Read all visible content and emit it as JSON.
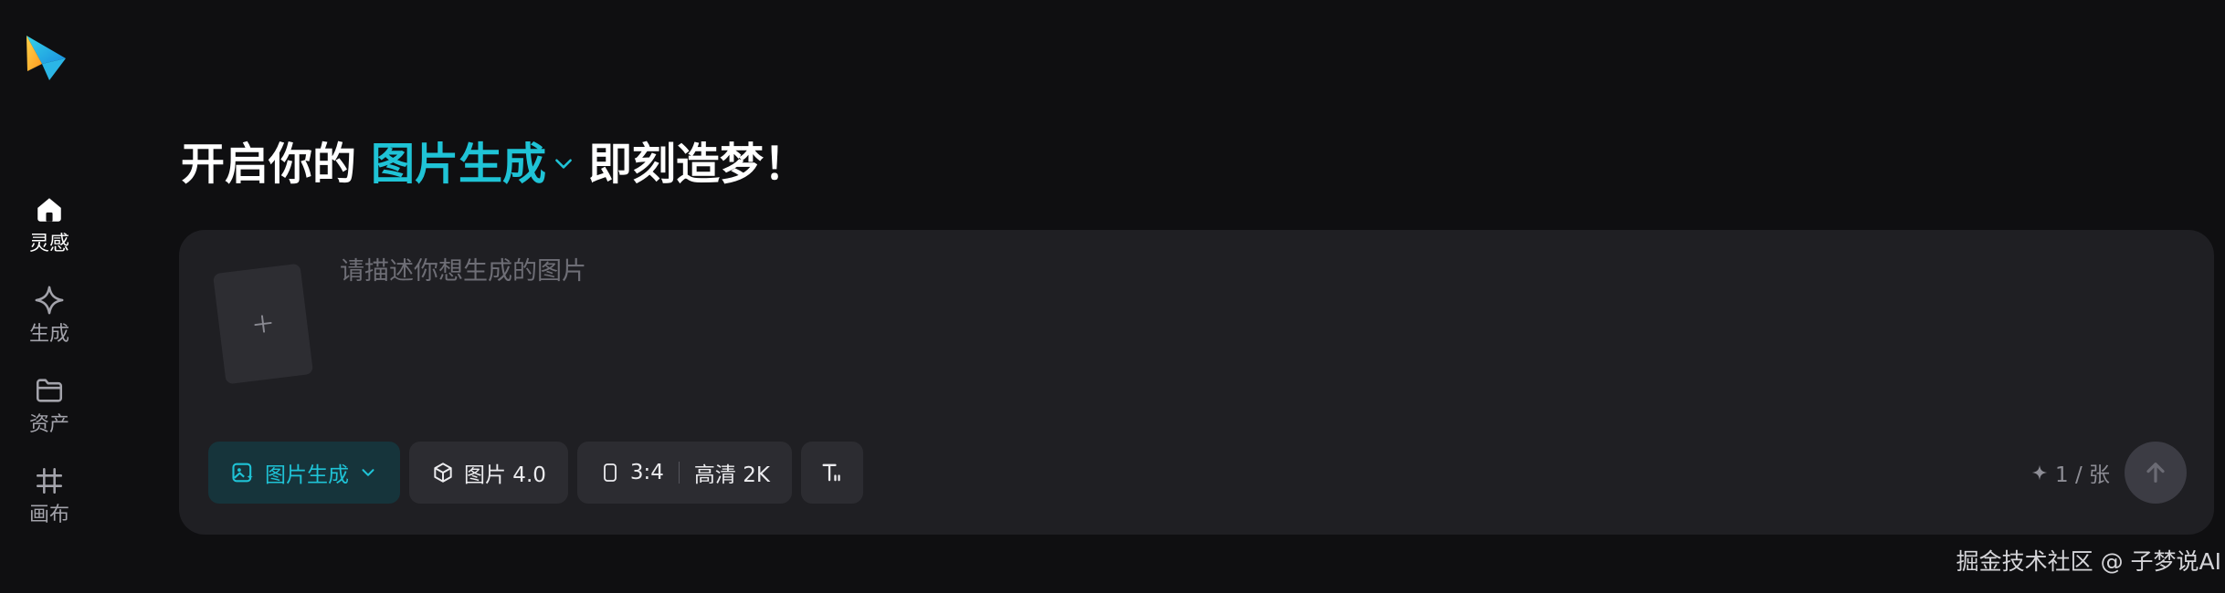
{
  "app": {
    "logo_icon": "paper-plane-logo-icon"
  },
  "sidebar": {
    "items": [
      {
        "label": "灵感",
        "icon": "home-icon",
        "active": true
      },
      {
        "label": "生成",
        "icon": "sparkle-icon",
        "active": false
      },
      {
        "label": "资产",
        "icon": "folder-icon",
        "active": false
      },
      {
        "label": "画布",
        "icon": "canvas-grid-icon",
        "active": false
      }
    ]
  },
  "headline": {
    "prefix": "开启你的",
    "mode": "图片生成",
    "suffix": "即刻造梦！"
  },
  "composer": {
    "placeholder": "请描述你想生成的图片",
    "value": "",
    "upload_icon": "plus-icon",
    "toolbar": {
      "mode_label": "图片生成",
      "model_label": "图片 4.0",
      "ratio_label": "3:4",
      "quality_label": "高清 2K",
      "text_style_icon": "text-format-icon"
    },
    "cost_label": "1 / 张",
    "send_icon": "arrow-up-icon"
  },
  "watermark": "掘金技术社区 @ 子梦说AI",
  "colors": {
    "background": "#0f0f11",
    "panel": "#1f1f23",
    "accent": "#1fc3d6",
    "button": "#2c2c31"
  }
}
